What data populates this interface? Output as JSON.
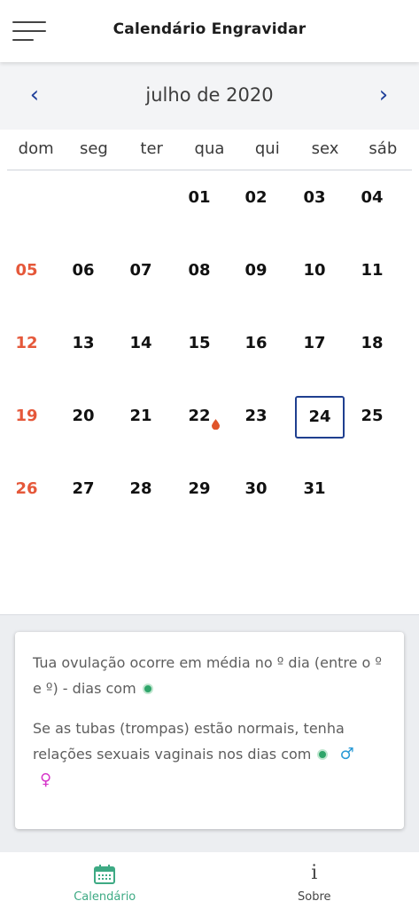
{
  "app": {
    "title": "Calendário Engravidar"
  },
  "calendar": {
    "month_title": "julho de 2020",
    "prev_icon": "chevron-left-icon",
    "next_icon": "chevron-right-icon",
    "weekdays": [
      "dom",
      "seg",
      "ter",
      "qua",
      "qui",
      "sex",
      "sáb"
    ],
    "start_weekday_index": 3,
    "days_in_month": 31,
    "labels": [
      "01",
      "02",
      "03",
      "04",
      "05",
      "06",
      "07",
      "08",
      "09",
      "10",
      "11",
      "12",
      "13",
      "14",
      "15",
      "16",
      "17",
      "18",
      "19",
      "20",
      "21",
      "22",
      "23",
      "24",
      "25",
      "26",
      "27",
      "28",
      "29",
      "30",
      "31"
    ],
    "today": 24,
    "period_day": 22,
    "sunday_color": "#e5583a",
    "period_color": "#e0542a",
    "today_border_color": "#1f3f8f"
  },
  "info": {
    "ovulation_text": "Tua ovulação ocorre em média no º dia (entre o º e º) - dias com",
    "tubes_text": "Se as tubas (trompas) estão normais, tenha relações sexuais vaginais nos dias com",
    "fertile_dot_color": "#2fa56a",
    "male_symbol": "♂",
    "female_symbol": "♀"
  },
  "bottom_nav": {
    "calendar_label": "Calendário",
    "about_label": "Sobre",
    "active_color": "#3eaa84"
  }
}
